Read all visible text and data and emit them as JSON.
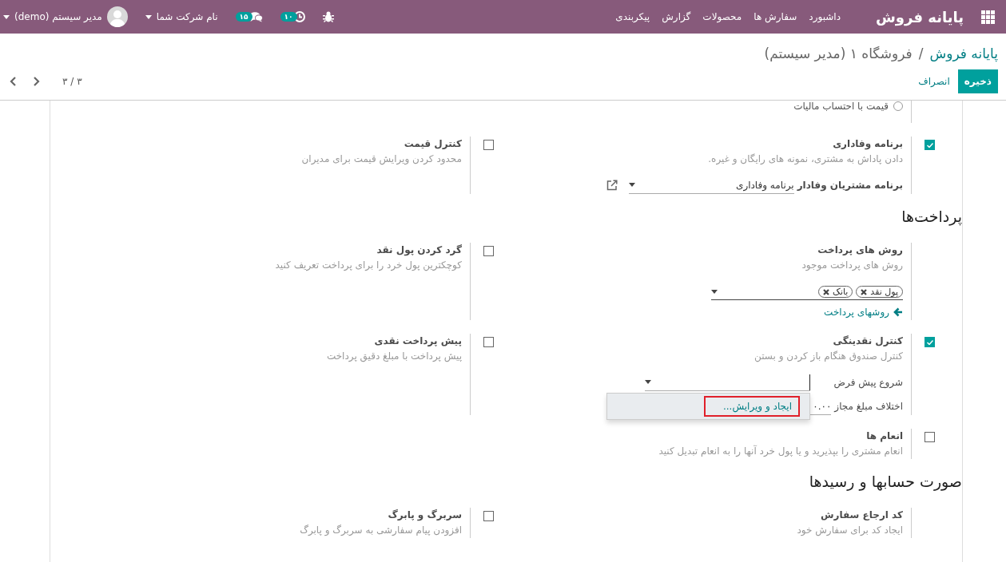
{
  "navbar": {
    "brand": "پایانه فروش",
    "menu": [
      "داشبورد",
      "سفارش ها",
      "محصولات",
      "گزارش",
      "پیکربندی"
    ],
    "activity_count": "۱۰",
    "message_count": "۱۵",
    "company": "نام شرکت شما",
    "user": "مدیر سیستم (demo)"
  },
  "breadcrumb": {
    "parent": "پایانه فروش",
    "separator": "/",
    "current": "فروشگاه ۱ (مدیر سیستم)"
  },
  "buttons": {
    "save": "ذخیره",
    "discard": "انصراف"
  },
  "pager": "۳ / ۳",
  "sections": [
    {
      "rows": [
        [
          {
            "kind": "options",
            "options": [
              {
                "label": "قیمت با احتساب مالیات",
                "selected": false
              }
            ]
          }
        ],
        [
          {
            "kind": "checkbox",
            "checked": true,
            "title": "برنامه وفاداری",
            "description": "دادن پاداش به مشتری، نمونه های رایگان و غیره.",
            "fields": [
              {
                "kind": "select",
                "label": "برنامه مشتریان وفادار",
                "value": "برنامه وفاداری",
                "link_icon": true
              }
            ]
          },
          {
            "kind": "checkbox",
            "checked": false,
            "title": "کنترل قیمت",
            "description": "محدود کردن ویرایش قیمت برای مدیران"
          }
        ]
      ]
    },
    {
      "heading": "پرداخت‌ها",
      "rows": [
        [
          {
            "kind": "plain",
            "title": "روش های پرداخت",
            "description": "روش های پرداخت موجود",
            "tags": [
              "پول نقد",
              "بانک"
            ],
            "link": "روشهای پرداخت"
          },
          {
            "kind": "checkbox",
            "checked": false,
            "title": "گرد کردن پول نقد",
            "description": "کوچکترین پول خرد را برای پرداخت تعریف کنید"
          }
        ],
        [
          {
            "kind": "checkbox",
            "checked": true,
            "title": "کنترل نقدینگی",
            "description": "کنترل صندوق هنگام باز کردن و بستن",
            "fields": [
              {
                "kind": "select",
                "label": "شروع پیش فرض",
                "focused": true,
                "menu": [
                  {
                    "label": "ایجاد و ویرایش...",
                    "highlighted": true
                  }
                ]
              },
              {
                "kind": "number",
                "label": "اختلاف مبلغ مجاز",
                "value": "۰.۰۰"
              }
            ]
          },
          {
            "kind": "checkbox",
            "checked": false,
            "title": "پیش پرداخت نقدی",
            "description": "پیش پرداخت با مبلغ دقیق پرداخت"
          }
        ],
        [
          {
            "kind": "checkbox",
            "checked": false,
            "title": "انعام ها",
            "description": "انعام مشتری را بپذیرید و یا پول خرد آنها را به انعام تبدیل کنید"
          }
        ]
      ]
    },
    {
      "heading": "صورت حسابها و رسیدها",
      "rows": [
        [
          {
            "kind": "plain",
            "title": "کد ارجاع سفارش",
            "description": "ایجاد کد برای سفارش خود"
          },
          {
            "kind": "checkbox",
            "checked": false,
            "title": "سربرگ و پابرگ",
            "description": "افزودن پیام سفارشی به سربرگ و پابرگ"
          }
        ]
      ]
    }
  ]
}
